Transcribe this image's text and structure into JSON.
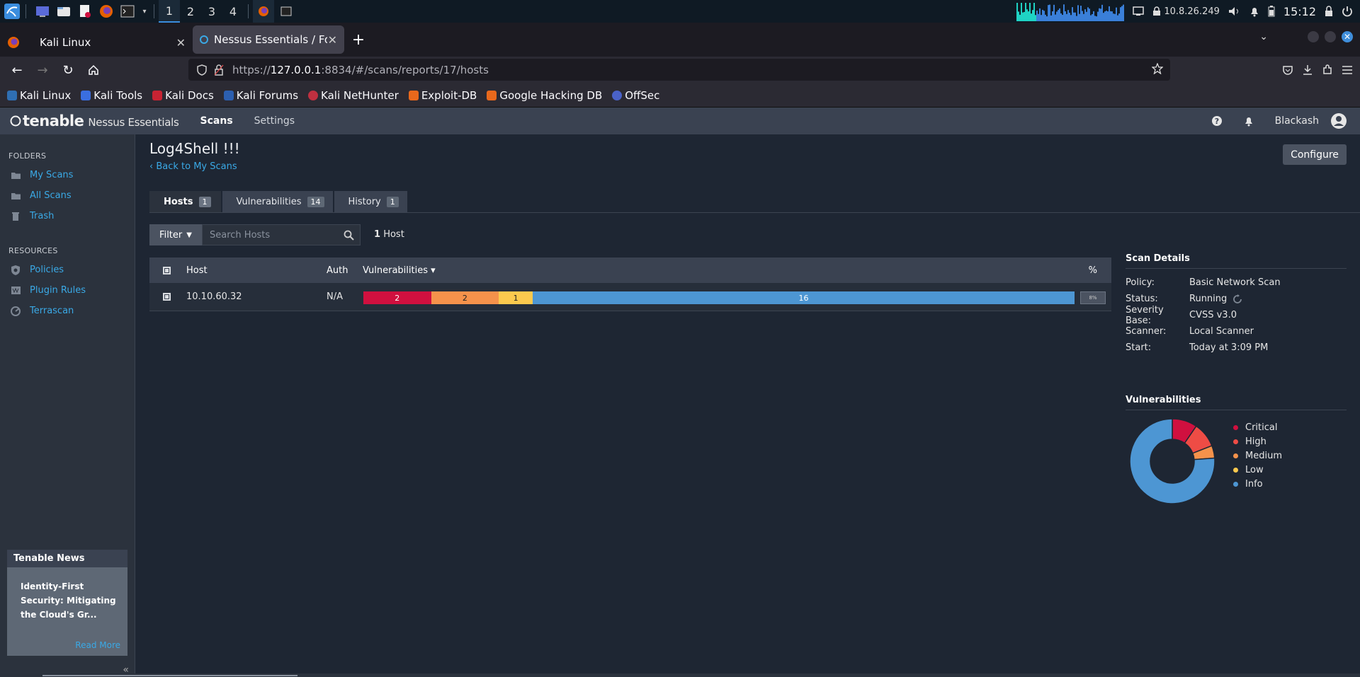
{
  "kali_panel": {
    "workspaces": [
      "1",
      "2",
      "3",
      "4"
    ],
    "active_workspace": "1",
    "ip": "10.8.26.249",
    "time": "15:12"
  },
  "browser": {
    "tabs": [
      {
        "title": "Kali Linux"
      },
      {
        "title": "Nessus Essentials / Folde"
      }
    ],
    "url_prefix": "https://",
    "url_host": "127.0.0.1",
    "url_rest": ":8834/#/scans/reports/17/hosts",
    "bookmarks": [
      "Kali Linux",
      "Kali Tools",
      "Kali Docs",
      "Kali Forums",
      "Kali NetHunter",
      "Exploit-DB",
      "Google Hacking DB",
      "OffSec"
    ]
  },
  "header": {
    "logo_brand": "tenable",
    "logo_product": "Nessus Essentials",
    "nav": [
      "Scans",
      "Settings"
    ],
    "user": "Blackash"
  },
  "sidebar": {
    "folders_heading": "FOLDERS",
    "folders": [
      "My Scans",
      "All Scans",
      "Trash"
    ],
    "resources_heading": "RESOURCES",
    "resources": [
      "Policies",
      "Plugin Rules",
      "Terrascan"
    ],
    "news": {
      "heading": "Tenable News",
      "body": "Identity-First Security: Mitigating the Cloud's Gr...",
      "more": "Read More"
    }
  },
  "main": {
    "title": "Log4Shell !!!",
    "back": "Back to My Scans",
    "configure": "Configure",
    "tabs": [
      {
        "label": "Hosts",
        "count": "1"
      },
      {
        "label": "Vulnerabilities",
        "count": "14"
      },
      {
        "label": "History",
        "count": "1"
      }
    ],
    "filter": "Filter",
    "search_placeholder": "Search Hosts",
    "host_count_num": "1",
    "host_count_label": "Host",
    "table": {
      "headers": {
        "host": "Host",
        "auth": "Auth",
        "vulns": "Vulnerabilities ▾",
        "pct": "%"
      },
      "rows": [
        {
          "host": "10.10.60.32",
          "auth": "N/A",
          "critical": 2,
          "high": 2,
          "medium": 1,
          "info": 16,
          "pct": "8%"
        }
      ]
    }
  },
  "scan_details": {
    "heading": "Scan Details",
    "rows": [
      {
        "k": "Policy:",
        "v": "Basic Network Scan"
      },
      {
        "k": "Status:",
        "v": "Running"
      },
      {
        "k": "Severity Base:",
        "v": "CVSS v3.0"
      },
      {
        "k": "Scanner:",
        "v": "Local Scanner"
      },
      {
        "k": "Start:",
        "v": "Today at 3:09 PM"
      }
    ]
  },
  "vulnerabilities_panel": {
    "heading": "Vulnerabilities",
    "legend": [
      "Critical",
      "High",
      "Medium",
      "Low",
      "Info"
    ]
  },
  "chart_data": {
    "type": "pie",
    "categories": [
      "Critical",
      "High",
      "Medium",
      "Low",
      "Info"
    ],
    "values": [
      2,
      2,
      1,
      0,
      16
    ],
    "colors": [
      "#d0103f",
      "#ee4c45",
      "#f5924b",
      "#fbc94e",
      "#4d96d3"
    ]
  }
}
